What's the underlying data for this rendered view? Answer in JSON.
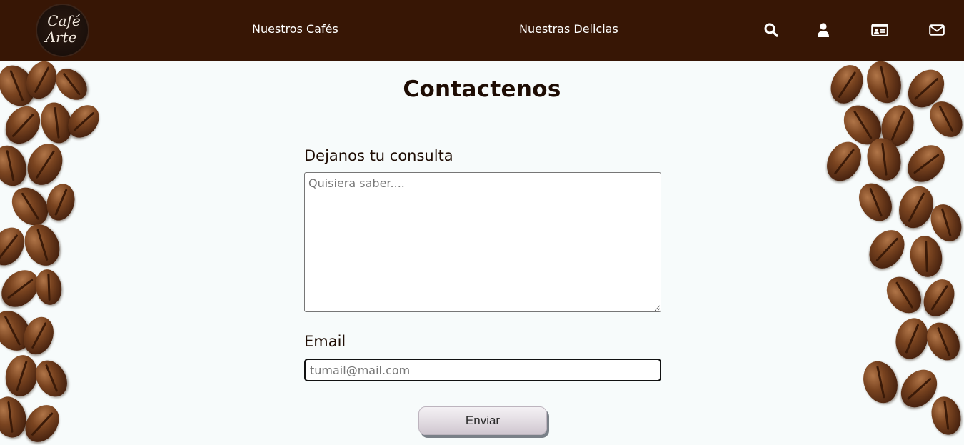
{
  "header": {
    "logo": {
      "line1": "Café",
      "line2": "Arte"
    },
    "nav": [
      {
        "label": "Nuestros Cafés"
      },
      {
        "label": "Nuestras Delicias"
      }
    ],
    "icons": [
      "search-icon",
      "user-icon",
      "id-card-icon",
      "mail-icon"
    ],
    "background_color": "#371605"
  },
  "main": {
    "title": "Contactenos",
    "consulta": {
      "label": "Dejanos tu consulta",
      "placeholder": "Quisiera saber....",
      "value": ""
    },
    "email": {
      "label": "Email",
      "placeholder": "tumail@mail.com",
      "value": ""
    },
    "submit_label": "Enviar"
  },
  "colors": {
    "header": "#371605",
    "title_text": "#1e0c03",
    "page_background": "#f7fbfb"
  }
}
